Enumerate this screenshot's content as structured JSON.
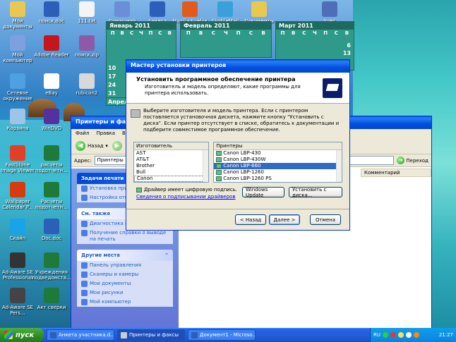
{
  "desktop_icons": [
    {
      "label": "Мои документы"
    },
    {
      "label": "поиск.doc"
    },
    {
      "label": "111.txt"
    },
    {
      "label": "Домашний компьютер"
    },
    {
      "label": "Анкета участника.doc"
    },
    {
      "label": "Mozilla Firefox"
    },
    {
      "label": "SkyFileMail"
    },
    {
      "label": "Документы"
    },
    {
      "label": "Учет"
    },
    {
      "label": "Мой компьютер"
    },
    {
      "label": "Adobe Reader"
    },
    {
      "label": "поиск.zip"
    },
    {
      "label": "Сетевое окружение"
    },
    {
      "label": "eBay"
    },
    {
      "label": "rubicon2"
    },
    {
      "label": "Корзина"
    },
    {
      "label": "WinDVD"
    },
    {
      "label": "FastStone Image Viewer"
    },
    {
      "label": "расчеты подотчетн..."
    },
    {
      "label": "Wallpaper Calendar P..."
    },
    {
      "label": "Расчеты подотчетн..."
    },
    {
      "label": "Скайп"
    },
    {
      "label": "Doc.doc"
    },
    {
      "label": "Ad-Aware SE Professional"
    },
    {
      "label": "Учреждения подведомств..."
    },
    {
      "label": "Ad-Aware SE Pers..."
    },
    {
      "label": "Акт сверки"
    }
  ],
  "calendar": {
    "month1": "Январь 2011",
    "month2": "Февраль 2011",
    "month3": "Март 2011",
    "month4": "Апрель",
    "weekdays": [
      "П",
      "В",
      "С",
      "Ч",
      "П",
      "С",
      "В"
    ],
    "month3_nums": [
      "6",
      "13"
    ],
    "month1_nums": [
      "10",
      "17",
      "24",
      "31"
    ]
  },
  "explorer": {
    "title": "Принтеры и факсы",
    "menu": [
      "Файл",
      "Правка",
      "Вид"
    ],
    "back_label": "Назад",
    "address_label": "Адрес:",
    "address_value": "Принтеры",
    "go_label": "Переход",
    "column_comment": "Комментарий",
    "printer_tasks": {
      "title": "Задачи печати",
      "items": [
        "Установка принтера",
        "Настройка отправки"
      ]
    },
    "see_also": {
      "title": "См. также",
      "items": [
        "Диагностика печати",
        "Получение справки о выводе на печать"
      ]
    },
    "other_places": {
      "title": "Другие места",
      "items": [
        "Панель управления",
        "Сканеры и камеры",
        "Мои документы",
        "Мои рисунки",
        "Мой компьютер"
      ]
    }
  },
  "wizard": {
    "title": "Мастер установки принтеров",
    "heading": "Установить программное обеспечение принтера",
    "subheading": "Изготовитель и модель определяют, какие программы для принтера использовать.",
    "description": "Выберите изготовителя и модель принтера. Если с принтером поставляется установочная дискета, нажмите кнопку \"Установить с диска\". Если принтер отсутствует в списке, обратитесь к документации и подберите совместимое программное обеспечение.",
    "manufacturer_header": "Изготовитель",
    "manufacturers": [
      "AST",
      "AT&T",
      "Brother",
      "Bull",
      "Canon"
    ],
    "selected_manufacturer": "Canon",
    "printers_header": "Принтеры",
    "printers": [
      "Canon LBP-430",
      "Canon LBP-430W",
      "Canon LBP-660",
      "Canon LBP-1260",
      "Canon LBP-1260 PS"
    ],
    "selected_printer": "Canon LBP-660",
    "driver_signed": "Драйвер имеет цифровую подпись.",
    "driver_link": "Сведения о подписывании драйверов",
    "windows_update": "Windows Update",
    "have_disk": "Установить с диска...",
    "back": "< Назад",
    "next": "Далее >",
    "cancel": "Отмена"
  },
  "taskbar": {
    "start": "пуск",
    "tasks": [
      "Анкета участника.d...",
      "Принтеры и факсы",
      "Документ1 - Microso..."
    ],
    "active_task": "Принтеры и факсы",
    "lang": "RU",
    "clock": "21:27"
  }
}
